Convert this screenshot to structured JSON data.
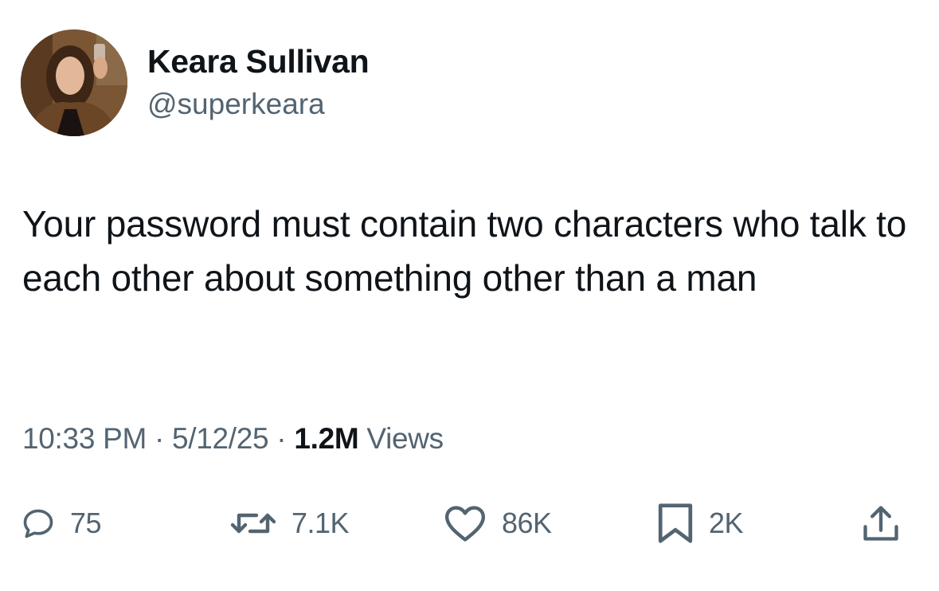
{
  "author": {
    "display_name": "Keara Sullivan",
    "handle": "@superkeara"
  },
  "tweet": {
    "text": "Your password must contain two characters who talk to each other about something other than a man"
  },
  "meta": {
    "time": "10:33 PM",
    "separator_1": " · ",
    "date": "5/12/25",
    "separator_2": " · ",
    "views_count": "1.2M",
    "views_label": " Views"
  },
  "actions": {
    "replies": {
      "icon": "reply-icon",
      "count": "75"
    },
    "reposts": {
      "icon": "repost-icon",
      "count": "7.1K"
    },
    "likes": {
      "icon": "heart-icon",
      "count": "86K"
    },
    "bookmarks": {
      "icon": "bookmark-icon",
      "count": "2K"
    },
    "share": {
      "icon": "share-icon"
    }
  },
  "colors": {
    "text_primary": "#0f1419",
    "text_secondary": "#536471",
    "background": "#ffffff"
  }
}
